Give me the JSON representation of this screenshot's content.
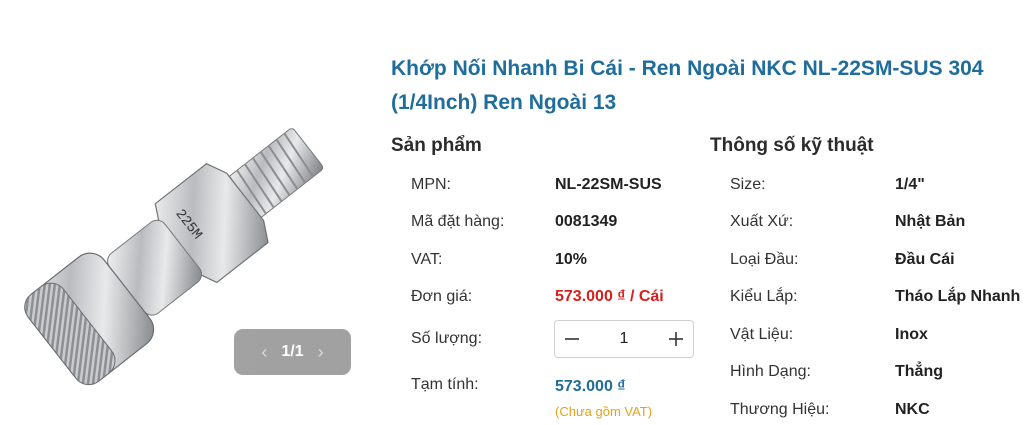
{
  "product": {
    "title": "Khớp Nối Nhanh Bi Cái - Ren Ngoài NKC NL-22SM-SUS 304 (1/4Inch) Ren Ngoài 13",
    "image_engraving": "225M",
    "gallery": {
      "counter": "1/1",
      "prev_icon": "chevron-left-icon",
      "next_icon": "chevron-right-icon"
    }
  },
  "info": {
    "heading": "Sản phẩm",
    "mpn_label": "MPN:",
    "mpn_value": "NL-22SM-SUS",
    "order_code_label": "Mã đặt hàng:",
    "order_code_value": "0081349",
    "vat_label": "VAT:",
    "vat_value": "10%",
    "unit_price_label": "Đơn giá:",
    "unit_price_value": "573.000 ₫ / Cái",
    "quantity_label": "Số lượng:",
    "quantity_value": "1",
    "minus_icon": "minus-icon",
    "plus_icon": "plus-icon",
    "subtotal_label": "Tạm tính:",
    "subtotal_value": "573.000 ₫",
    "vat_note": "(Chưa gồm VAT)"
  },
  "specs": {
    "heading": "Thông số kỹ thuật",
    "rows": [
      {
        "label": "Size:",
        "value": "1/4\""
      },
      {
        "label": "Xuất Xứ:",
        "value": "Nhật Bản"
      },
      {
        "label": "Loại Đầu:",
        "value": "Đầu Cái"
      },
      {
        "label": "Kiểu Lắp:",
        "value": "Tháo Lắp Nhanh"
      },
      {
        "label": "Vật Liệu:",
        "value": "Inox"
      },
      {
        "label": "Hình Dạng:",
        "value": "Thẳng"
      },
      {
        "label": "Thương Hiệu:",
        "value": "NKC"
      }
    ]
  },
  "colors": {
    "title": "#1f6d9b",
    "price": "#d6201d",
    "subtotal": "#1f6d9b",
    "vat_note": "#e3a21a"
  }
}
